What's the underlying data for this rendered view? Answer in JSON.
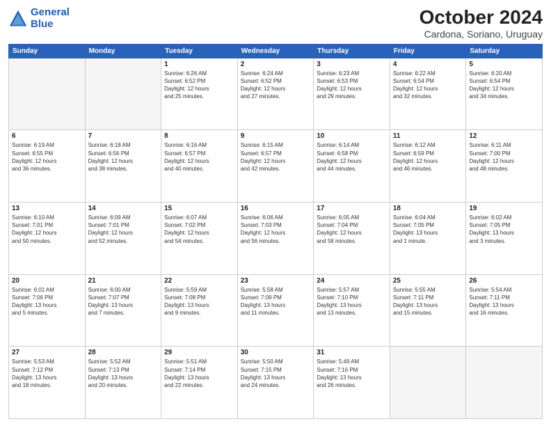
{
  "header": {
    "logo_line1": "General",
    "logo_line2": "Blue",
    "main_title": "October 2024",
    "subtitle": "Cardona, Soriano, Uruguay"
  },
  "days_of_week": [
    "Sunday",
    "Monday",
    "Tuesday",
    "Wednesday",
    "Thursday",
    "Friday",
    "Saturday"
  ],
  "weeks": [
    [
      {
        "day": "",
        "detail": ""
      },
      {
        "day": "",
        "detail": ""
      },
      {
        "day": "1",
        "detail": "Sunrise: 6:26 AM\nSunset: 6:52 PM\nDaylight: 12 hours\nand 25 minutes."
      },
      {
        "day": "2",
        "detail": "Sunrise: 6:24 AM\nSunset: 6:52 PM\nDaylight: 12 hours\nand 27 minutes."
      },
      {
        "day": "3",
        "detail": "Sunrise: 6:23 AM\nSunset: 6:53 PM\nDaylight: 12 hours\nand 29 minutes."
      },
      {
        "day": "4",
        "detail": "Sunrise: 6:22 AM\nSunset: 6:54 PM\nDaylight: 12 hours\nand 32 minutes."
      },
      {
        "day": "5",
        "detail": "Sunrise: 6:20 AM\nSunset: 6:54 PM\nDaylight: 12 hours\nand 34 minutes."
      }
    ],
    [
      {
        "day": "6",
        "detail": "Sunrise: 6:19 AM\nSunset: 6:55 PM\nDaylight: 12 hours\nand 36 minutes."
      },
      {
        "day": "7",
        "detail": "Sunrise: 6:18 AM\nSunset: 6:56 PM\nDaylight: 12 hours\nand 38 minutes."
      },
      {
        "day": "8",
        "detail": "Sunrise: 6:16 AM\nSunset: 6:57 PM\nDaylight: 12 hours\nand 40 minutes."
      },
      {
        "day": "9",
        "detail": "Sunrise: 6:15 AM\nSunset: 6:57 PM\nDaylight: 12 hours\nand 42 minutes."
      },
      {
        "day": "10",
        "detail": "Sunrise: 6:14 AM\nSunset: 6:58 PM\nDaylight: 12 hours\nand 44 minutes."
      },
      {
        "day": "11",
        "detail": "Sunrise: 6:12 AM\nSunset: 6:59 PM\nDaylight: 12 hours\nand 46 minutes."
      },
      {
        "day": "12",
        "detail": "Sunrise: 6:11 AM\nSunset: 7:00 PM\nDaylight: 12 hours\nand 48 minutes."
      }
    ],
    [
      {
        "day": "13",
        "detail": "Sunrise: 6:10 AM\nSunset: 7:01 PM\nDaylight: 12 hours\nand 50 minutes."
      },
      {
        "day": "14",
        "detail": "Sunrise: 6:09 AM\nSunset: 7:01 PM\nDaylight: 12 hours\nand 52 minutes."
      },
      {
        "day": "15",
        "detail": "Sunrise: 6:07 AM\nSunset: 7:02 PM\nDaylight: 12 hours\nand 54 minutes."
      },
      {
        "day": "16",
        "detail": "Sunrise: 6:06 AM\nSunset: 7:03 PM\nDaylight: 12 hours\nand 56 minutes."
      },
      {
        "day": "17",
        "detail": "Sunrise: 6:05 AM\nSunset: 7:04 PM\nDaylight: 12 hours\nand 58 minutes."
      },
      {
        "day": "18",
        "detail": "Sunrise: 6:04 AM\nSunset: 7:05 PM\nDaylight: 13 hours\nand 1 minute."
      },
      {
        "day": "19",
        "detail": "Sunrise: 6:02 AM\nSunset: 7:05 PM\nDaylight: 13 hours\nand 3 minutes."
      }
    ],
    [
      {
        "day": "20",
        "detail": "Sunrise: 6:01 AM\nSunset: 7:06 PM\nDaylight: 13 hours\nand 5 minutes."
      },
      {
        "day": "21",
        "detail": "Sunrise: 6:00 AM\nSunset: 7:07 PM\nDaylight: 13 hours\nand 7 minutes."
      },
      {
        "day": "22",
        "detail": "Sunrise: 5:59 AM\nSunset: 7:08 PM\nDaylight: 13 hours\nand 9 minutes."
      },
      {
        "day": "23",
        "detail": "Sunrise: 5:58 AM\nSunset: 7:09 PM\nDaylight: 13 hours\nand 11 minutes."
      },
      {
        "day": "24",
        "detail": "Sunrise: 5:57 AM\nSunset: 7:10 PM\nDaylight: 13 hours\nand 13 minutes."
      },
      {
        "day": "25",
        "detail": "Sunrise: 5:55 AM\nSunset: 7:11 PM\nDaylight: 13 hours\nand 15 minutes."
      },
      {
        "day": "26",
        "detail": "Sunrise: 5:54 AM\nSunset: 7:11 PM\nDaylight: 13 hours\nand 16 minutes."
      }
    ],
    [
      {
        "day": "27",
        "detail": "Sunrise: 5:53 AM\nSunset: 7:12 PM\nDaylight: 13 hours\nand 18 minutes."
      },
      {
        "day": "28",
        "detail": "Sunrise: 5:52 AM\nSunset: 7:13 PM\nDaylight: 13 hours\nand 20 minutes."
      },
      {
        "day": "29",
        "detail": "Sunrise: 5:51 AM\nSunset: 7:14 PM\nDaylight: 13 hours\nand 22 minutes."
      },
      {
        "day": "30",
        "detail": "Sunrise: 5:50 AM\nSunset: 7:15 PM\nDaylight: 13 hours\nand 24 minutes."
      },
      {
        "day": "31",
        "detail": "Sunrise: 5:49 AM\nSunset: 7:16 PM\nDaylight: 13 hours\nand 26 minutes."
      },
      {
        "day": "",
        "detail": ""
      },
      {
        "day": "",
        "detail": ""
      }
    ]
  ]
}
